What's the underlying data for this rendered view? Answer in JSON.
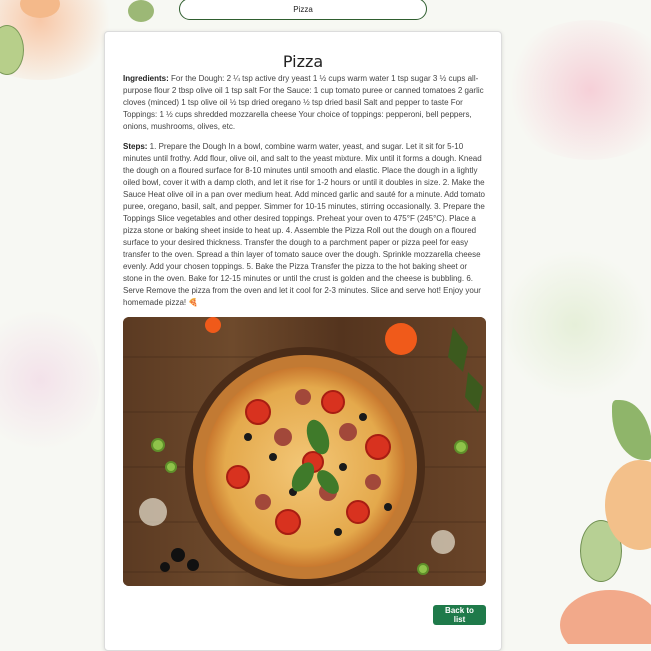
{
  "header": {
    "title": "Pizza"
  },
  "recipe": {
    "title": "Pizza",
    "ingredients_label": "Ingredients:",
    "ingredients_text": " For the Dough: 2 ¼ tsp active dry yeast 1 ½ cups warm water 1 tsp sugar 3 ½ cups all-purpose flour 2 tbsp olive oil 1 tsp salt For the Sauce: 1 cup tomato puree or canned tomatoes 2 garlic cloves (minced) 1 tsp olive oil ½ tsp dried oregano ½ tsp dried basil Salt and pepper to taste For Toppings: 1 ½ cups shredded mozzarella cheese Your choice of toppings: pepperoni, bell peppers, onions, mushrooms, olives, etc.",
    "steps_label": "Steps:",
    "steps_text": " 1. Prepare the Dough In a bowl, combine warm water, yeast, and sugar. Let it sit for 5-10 minutes until frothy. Add flour, olive oil, and salt to the yeast mixture. Mix until it forms a dough. Knead the dough on a floured surface for 8-10 minutes until smooth and elastic. Place the dough in a lightly oiled bowl, cover it with a damp cloth, and let it rise for 1-2 hours or until it doubles in size. 2. Make the Sauce Heat olive oil in a pan over medium heat. Add minced garlic and sauté for a minute. Add tomato puree, oregano, basil, salt, and pepper. Simmer for 10-15 minutes, stirring occasionally. 3. Prepare the Toppings Slice vegetables and other desired toppings. Preheat your oven to 475°F (245°C). Place a pizza stone or baking sheet inside to heat up. 4. Assemble the Pizza Roll out the dough on a floured surface to your desired thickness. Transfer the dough to a parchment paper or pizza peel for easy transfer to the oven. Spread a thin layer of tomato sauce over the dough. Sprinkle mozzarella cheese evenly. Add your chosen toppings. 5. Bake the Pizza Transfer the pizza to the hot baking sheet or stone in the oven. Bake for 12-15 minutes or until the crust is golden and the cheese is bubbling. 6. Serve Remove the pizza from the oven and let it cool for 2-3 minutes. Slice and serve hot! Enjoy your homemade pizza! 🍕"
  },
  "actions": {
    "back_label": "Back to list"
  },
  "colors": {
    "button_bg": "#1f7a4a",
    "pill_border": "#2f5e2f"
  }
}
